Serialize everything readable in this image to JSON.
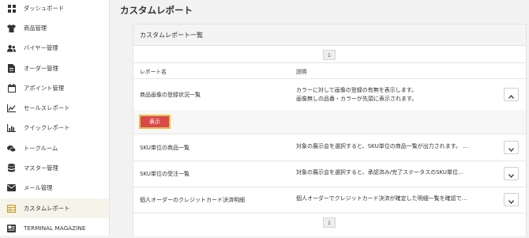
{
  "sidebar": {
    "items": [
      {
        "label": "ダッシュボード",
        "icon": "dashboard-icon"
      },
      {
        "label": "商品管理",
        "icon": "tshirt-icon"
      },
      {
        "label": "バイヤー管理",
        "icon": "users-icon"
      },
      {
        "label": "オーダー管理",
        "icon": "document-icon"
      },
      {
        "label": "アポイント管理",
        "icon": "calendar-icon"
      },
      {
        "label": "セールスレポート",
        "icon": "line-chart-icon"
      },
      {
        "label": "クイックレポート",
        "icon": "bar-chart-icon"
      },
      {
        "label": "トークルーム",
        "icon": "chat-icon"
      },
      {
        "label": "マスター管理",
        "icon": "database-icon"
      },
      {
        "label": "メール管理",
        "icon": "mail-icon"
      },
      {
        "label": "カスタムレポート",
        "icon": "table-icon"
      },
      {
        "label": "TERMINAL MAGAZINE",
        "icon": "magazine-icon"
      }
    ],
    "active_index": 10,
    "accent_color": "#c9a227"
  },
  "page": {
    "title": "カスタムレポート"
  },
  "card": {
    "title": "カスタムレポート一覧",
    "page_number": "1",
    "columns": {
      "name": "レポート名",
      "description": "説明"
    },
    "rows": [
      {
        "name": "商品画像の登録状況一覧",
        "desc1": "カラーに対して画像の登録の有無を表示します。",
        "desc2": "画像無しの品番・カラーが先頭に表示されます。",
        "expanded": true
      },
      {
        "name": "SKU単位の商品一覧",
        "desc1": "対象の展示会を選択すると、SKU単位の商品一覧が出力されます。 …",
        "expanded": false
      },
      {
        "name": "SKU単位の受注一覧",
        "desc1": "対象の展示会を選択すると、承認済み/完了ステータスのSKU単位…",
        "expanded": false
      },
      {
        "name": "個人オーダーのクレジットカード決済明細",
        "desc1": "個人オーダーでクレジットカード決済が確定した明細一覧を確認で…",
        "expanded": false
      }
    ],
    "show_button": "表示",
    "button_color": "#d9494a"
  }
}
